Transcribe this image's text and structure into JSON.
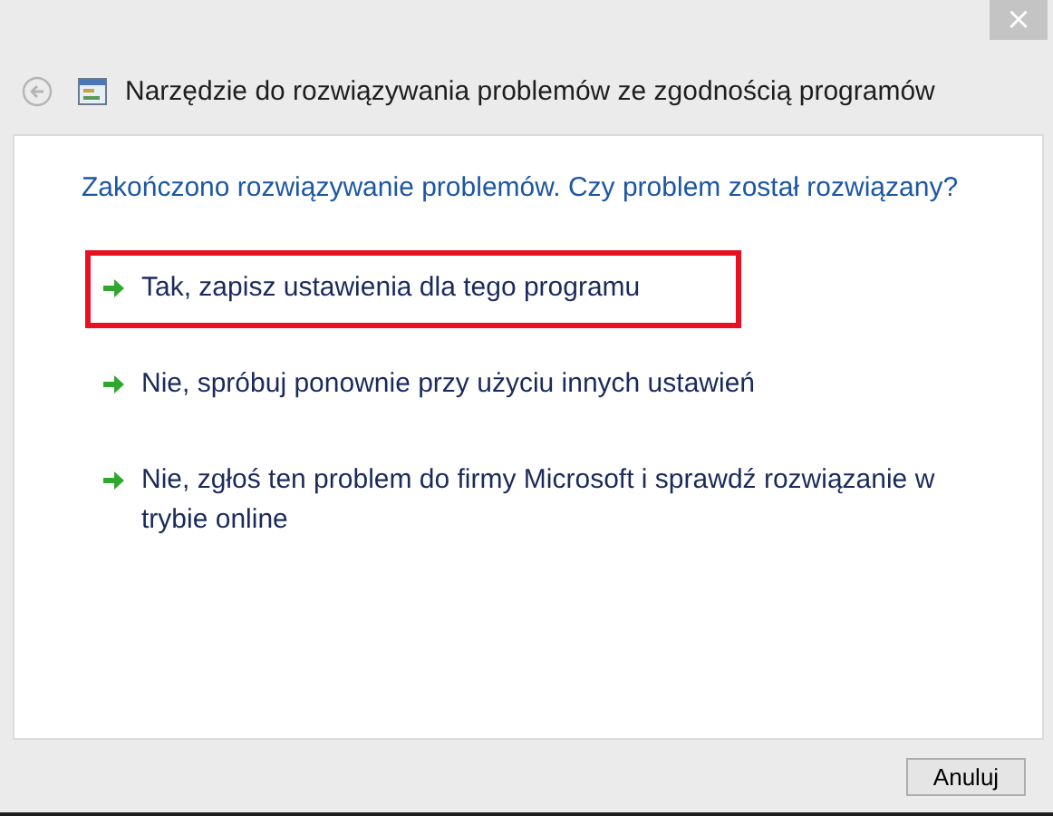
{
  "window": {
    "title": "Narzędzie do rozwiązywania problemów ze zgodnością programów",
    "close": "×"
  },
  "heading": "Zakończono rozwiązywanie problemów. Czy problem został rozwiązany?",
  "options": [
    {
      "label": "Tak, zapisz ustawienia dla tego programu",
      "highlighted": true
    },
    {
      "label": "Nie, spróbuj ponownie przy użyciu innych ustawień",
      "highlighted": false
    },
    {
      "label": "Nie, zgłoś ten problem do firmy Microsoft i sprawdź rozwiązanie w trybie online",
      "highlighted": false
    }
  ],
  "buttons": [
    {
      "label": "Anuluj"
    }
  ]
}
